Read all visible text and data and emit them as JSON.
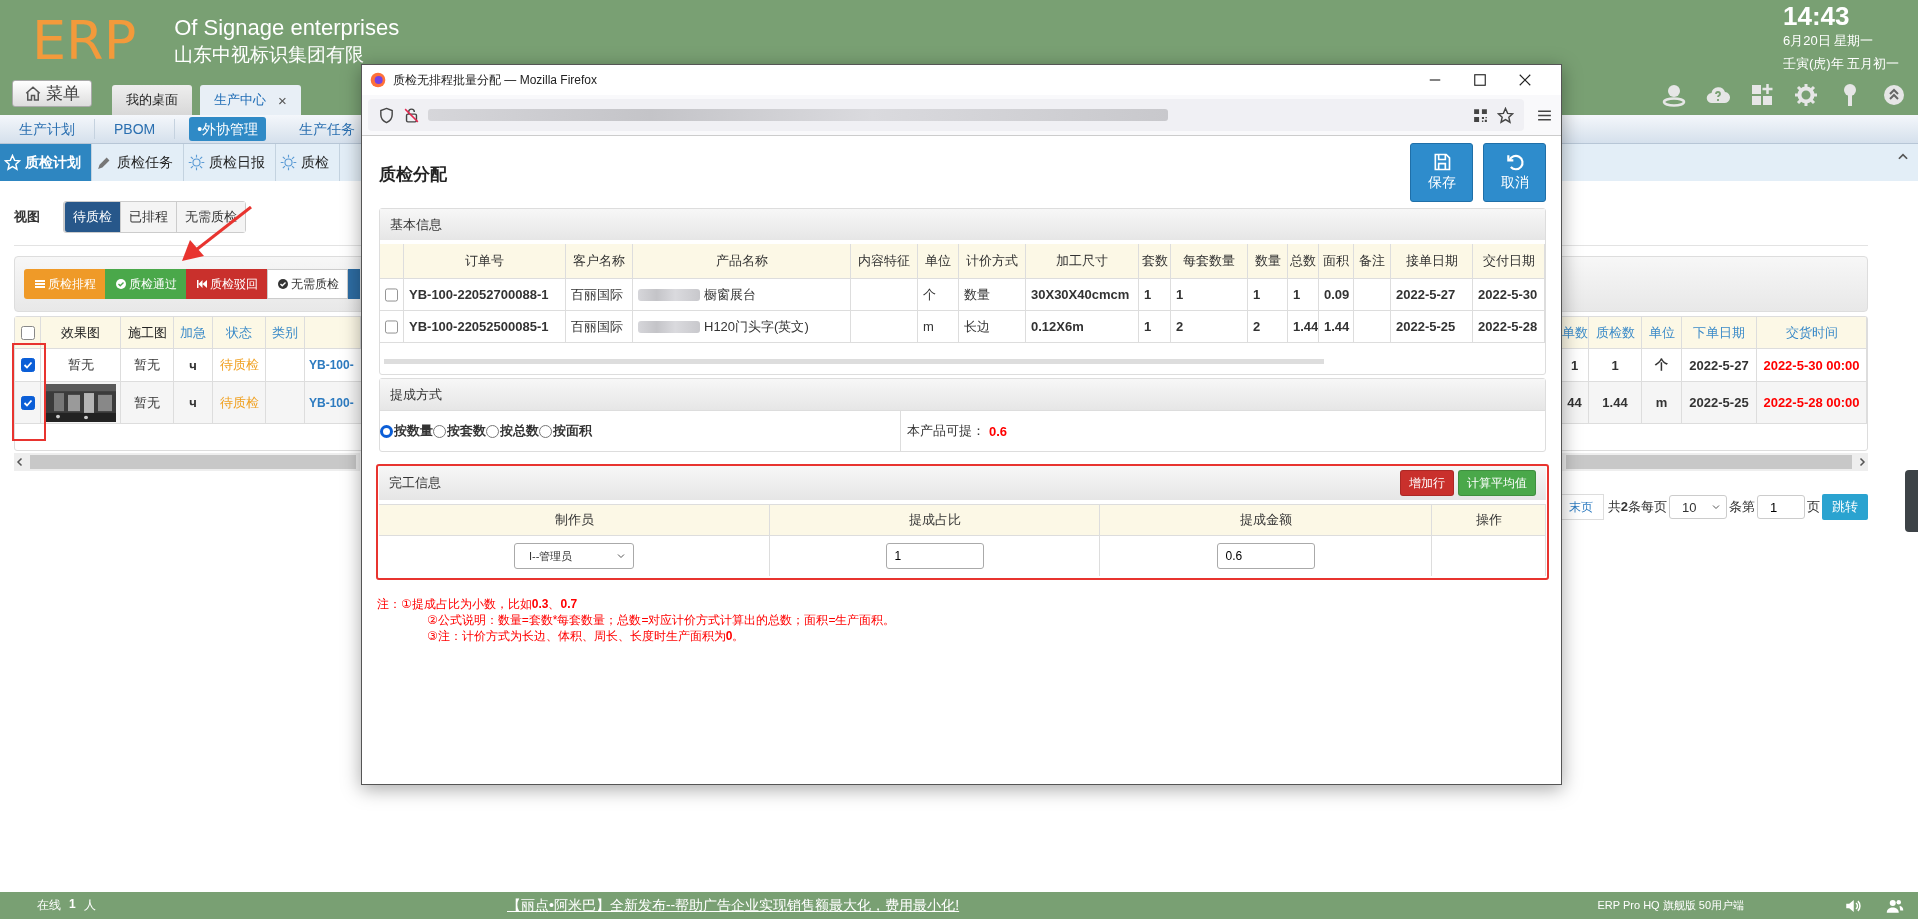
{
  "header": {
    "logo": "ERP",
    "title": "Of Signage enterprises",
    "subtitle": "山东中视标识集团有限",
    "menu_button": "菜单",
    "tabs": [
      {
        "label": "我的桌面",
        "selected": false,
        "closable": false
      },
      {
        "label": "生产中心",
        "selected": true,
        "closable": true,
        "close": "×"
      }
    ],
    "clock": {
      "time": "14:43",
      "date": "6月20日 星期一",
      "lunar": "壬寅(虎)年 五月初一"
    }
  },
  "nav_bar": {
    "items": [
      {
        "label": "生产计划",
        "selected": false
      },
      {
        "label": "PBOM",
        "selected": false
      },
      {
        "label": "•外协管理",
        "selected": true
      },
      {
        "label": "生产任务",
        "selected": false
      }
    ]
  },
  "sub_tabs": [
    {
      "label": "质检计划",
      "kind": "star",
      "selected": true
    },
    {
      "label": "质检任务",
      "kind": "pencil",
      "selected": false
    },
    {
      "label": "质检日报",
      "kind": "sun",
      "selected": false
    },
    {
      "label": "质检",
      "kind": "sun",
      "selected": false
    }
  ],
  "view_filter": {
    "label": "视图",
    "options": [
      {
        "label": "待质检",
        "selected": true
      },
      {
        "label": "已排程",
        "selected": false
      },
      {
        "label": "无需质检",
        "selected": false
      }
    ]
  },
  "actions": [
    {
      "label": "质检排程",
      "kind": "schedule"
    },
    {
      "label": "质检通过",
      "kind": "pass"
    },
    {
      "label": "质检驳回",
      "kind": "reject"
    },
    {
      "label": "无需质检",
      "kind": "skip"
    },
    {
      "kind": "more"
    }
  ],
  "table": {
    "header_checked": false,
    "columns": [
      {
        "label": "效果图",
        "kind": "picture",
        "sortable": false
      },
      {
        "label": "施工图",
        "kind": "text",
        "sortable": false
      },
      {
        "label": "加急",
        "kind": "urgent",
        "sortable": true
      },
      {
        "label": "状态",
        "kind": "status",
        "sortable": true
      },
      {
        "label": "类别",
        "kind": "blank",
        "sortable": true
      },
      {
        "kind": "link"
      },
      {
        "label": "单数",
        "kind": "number",
        "sortable": true
      },
      {
        "label": "质检数",
        "kind": "number",
        "sortable": true
      },
      {
        "label": "单位",
        "kind": "unit",
        "sortable": true
      },
      {
        "label": "下单日期",
        "kind": "date",
        "sortable": true
      },
      {
        "label": "交货时间",
        "kind": "deadline",
        "sortable": true
      }
    ],
    "rows": [
      {
        "checked": true,
        "cells": [
          "暂无",
          "暂无",
          "ч",
          "待质检",
          "",
          "YB-100-",
          "1",
          "1",
          "个",
          "2022-5-27",
          "2022-5-30 00:00"
        ]
      },
      {
        "checked": true,
        "cells": [
          {
            "kind": "picture"
          },
          "暂无",
          "ч",
          "待质检",
          "",
          "YB-100-",
          "44",
          "1.44",
          "m",
          "2022-5-25",
          "2022-5-28 00:00"
        ]
      }
    ]
  },
  "pagination": {
    "last": "末页",
    "total": "共**2**条每页",
    "page_size": "10",
    "page_label": "条第",
    "page": "1",
    "page_suffix": "页",
    "go": "跳转"
  },
  "popup": {
    "window_title": "质检无排程批量分配 — Mozilla Firefox",
    "heading": "质检分配",
    "buttons": [
      {
        "label": "保存",
        "kind": "save"
      },
      {
        "label": "取消",
        "kind": "cancel"
      }
    ],
    "basic_info": {
      "title": "基本信息",
      "columns": [
        {
          "label": "订单号",
          "kind": "bold"
        },
        {
          "label": "客户名称",
          "kind": "text"
        },
        {
          "label": "产品名称",
          "kind": "product"
        },
        {
          "label": "内容特征"
        },
        {
          "label": "单位",
          "kind": "text"
        },
        {
          "label": "计价方式",
          "kind": "text"
        },
        {
          "label": "加工尺寸",
          "kind": "bold"
        },
        {
          "label": "套数",
          "kind": "bold"
        },
        {
          "label": "每套数量",
          "kind": "bold"
        },
        {
          "label": "数量",
          "kind": "bold"
        },
        {
          "label": "总数",
          "kind": "bold"
        },
        {
          "label": "面积",
          "kind": "bold"
        },
        {
          "label": "备注"
        },
        {
          "label": "接单日期",
          "kind": "bold"
        },
        {
          "label": "交付日期",
          "kind": "bold"
        }
      ],
      "rows": [
        {
          "checked": false,
          "blurred": true,
          "cells": [
            "YB-100-22052700088-1",
            "百丽国际",
            "橱窗展台",
            "",
            "个",
            "数量",
            "30X30X40cmcm",
            "1",
            "1",
            "1",
            "1",
            "0.09",
            "",
            "2022-5-27",
            "2022-5-30"
          ]
        },
        {
          "checked": false,
          "blurred": true,
          "cells": [
            "YB-100-22052500085-1",
            "百丽国际",
            "H120门头字(英文)",
            "",
            "m",
            "长边",
            "0.12X6m",
            "1",
            "2",
            "2",
            "1.44",
            "1.44",
            "",
            "2022-5-25",
            "2022-5-28"
          ]
        }
      ]
    },
    "commission": {
      "title": "提成方式",
      "options": [
        {
          "label": "按数量",
          "selected": true
        },
        {
          "label": "按套数",
          "selected": false
        },
        {
          "label": "按总数",
          "selected": false
        },
        {
          "label": "按面积",
          "selected": false
        }
      ],
      "available_label": "本产品可提：",
      "available_value": "0.6"
    },
    "completion": {
      "title": "完工信息",
      "buttons": [
        {
          "label": "增加行",
          "kind": "add"
        },
        {
          "label": "计算平均值",
          "kind": "average"
        }
      ],
      "columns": [
        "制作员",
        "提成占比",
        "提成金额",
        "操作"
      ],
      "rows": [
        {
          "maker": "I--管理员",
          "ratio": "1",
          "amount": "0.6"
        }
      ]
    },
    "notes": [
      {
        "text": "注：①提成占比为小数，比如**0.3**、**0.7**",
        "indent": false
      },
      {
        "text": "②公式说明：数量=套数*每套数量；总数=对应计价方式计算出的总数；面积=生产面积。",
        "indent": true
      },
      {
        "text": "③注：计价方式为长边、体积、周长、长度时生产面积为**0**。",
        "indent": true
      }
    ]
  },
  "status_bar": {
    "online": "在线",
    "online_count": "1",
    "online_unit": "人",
    "announcement": "【丽点•阿米巴】全新发布--帮助广告企业实现销售额最大化，费用最小化!",
    "edition": "ERP Pro HQ 旗舰版 50用户端"
  }
}
